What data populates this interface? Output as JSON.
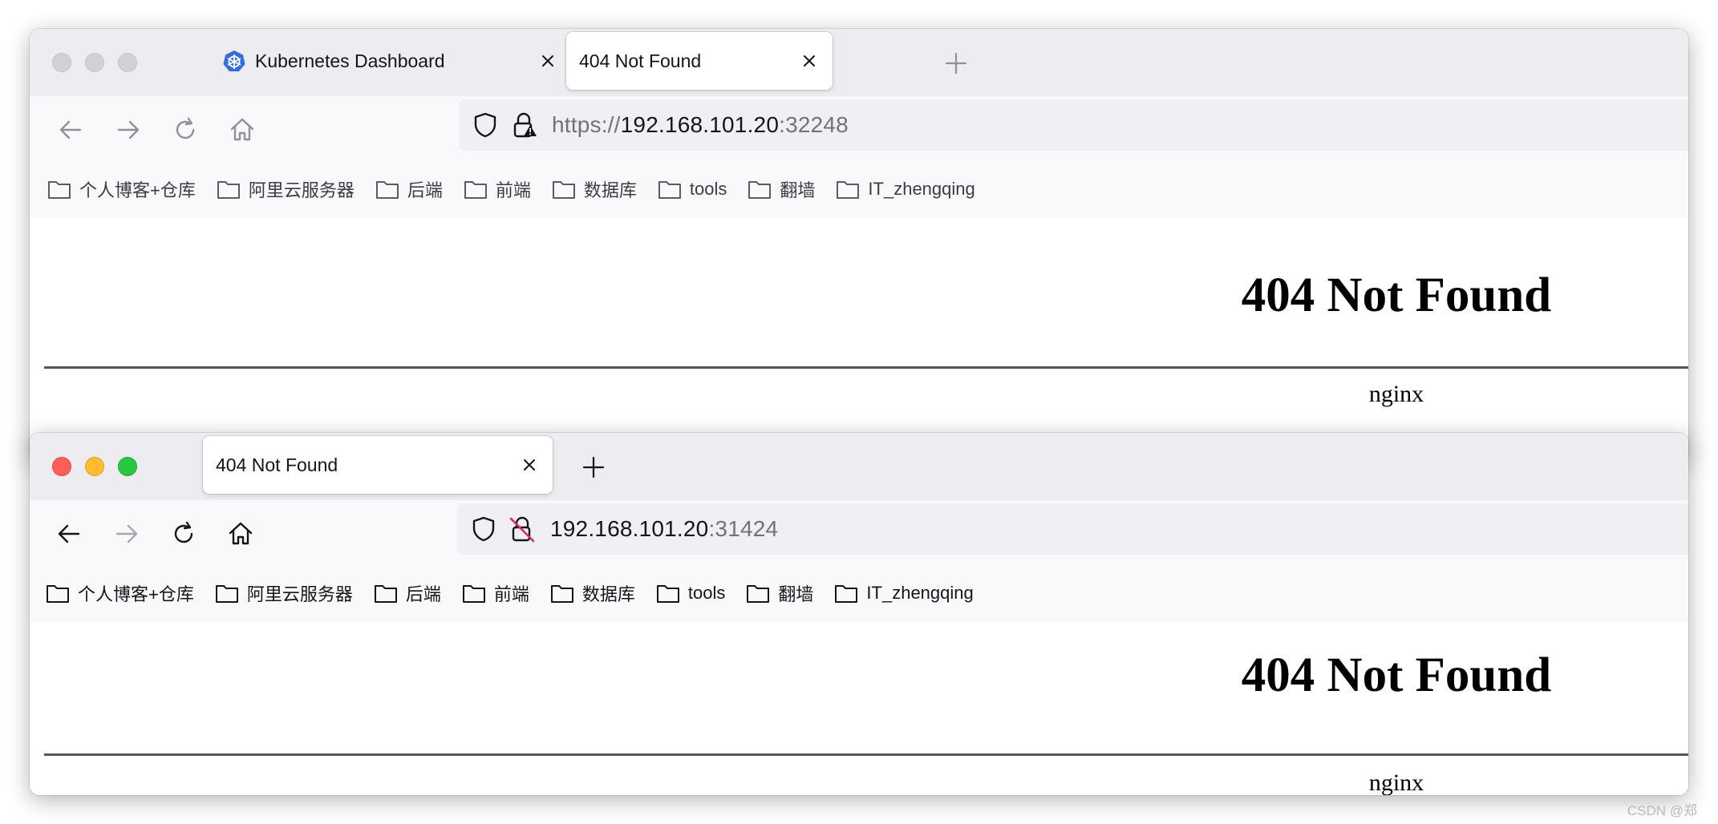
{
  "window_back": {
    "tabs": [
      {
        "title": "Kubernetes Dashboard",
        "favicon": "kubernetes-icon",
        "active": false
      },
      {
        "title": "404 Not Found",
        "active": true
      }
    ],
    "url": {
      "scheme": "https://",
      "host": "192.168.101.20",
      "port": ":32248"
    },
    "bookmarks": [
      "个人博客+仓库",
      "阿里云服务器",
      "后端",
      "前端",
      "数据库",
      "tools",
      "翻墙",
      "IT_zhengqing"
    ],
    "page": {
      "heading": "404 Not Found",
      "server": "nginx"
    }
  },
  "window_front": {
    "tabs": [
      {
        "title": "404 Not Found",
        "active": true
      }
    ],
    "url": {
      "host": "192.168.101.20",
      "port": ":31424"
    },
    "bookmarks": [
      "个人博客+仓库",
      "阿里云服务器",
      "后端",
      "前端",
      "数据库",
      "tools",
      "翻墙",
      "IT_zhengqing"
    ],
    "page": {
      "heading": "404 Not Found",
      "server": "nginx"
    }
  },
  "watermark": "CSDN @郑"
}
